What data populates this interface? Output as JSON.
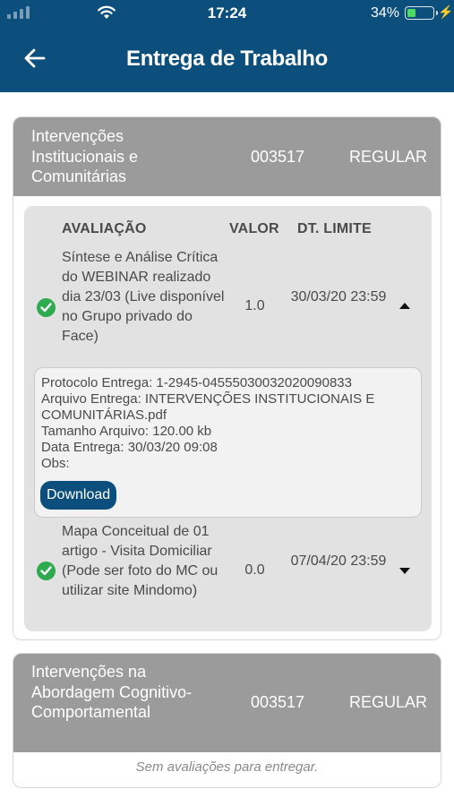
{
  "status_bar": {
    "time": "17:24",
    "battery_pct": "34%"
  },
  "header": {
    "title": "Entrega de Trabalho",
    "back_icon": "arrow-left-icon"
  },
  "colors": {
    "primary": "#0c4f7d",
    "card_header": "#9b9b9b",
    "success": "#2eaa4f"
  },
  "courses": [
    {
      "name": "Intervenções Institucionais e Comunitárias",
      "code": "003517",
      "status": "REGULAR",
      "table": {
        "col_eval": "AVALIAÇÃO",
        "col_value": "VALOR",
        "col_deadline": "DT. LIMITE"
      },
      "assessments": [
        {
          "description": "Síntese e Análise Crítica do WEBINAR realizado dia 23/03 (Live disponível no Grupo privado do Face)",
          "value": "1.0",
          "deadline": "30/03/20 23:59",
          "expanded": true,
          "detail": {
            "protocol_label": "Protocolo Entrega:",
            "protocol": "1-2945-04555030032020090833",
            "file_label": "Arquivo Entrega:",
            "file": "INTERVENÇÕES INSTITUCIONAIS E COMUNITÁRIAS.pdf",
            "size_label": "Tamanho Arquivo:",
            "size": "120.00 kb",
            "date_label": "Data Entrega:",
            "date": "30/03/20 09:08",
            "obs_label": "Obs:",
            "download_label": "Download"
          }
        },
        {
          "description": "Mapa Conceitual de 01 artigo - Visita Domiciliar (Pode ser foto do MC ou utilizar site Mindomo)",
          "value": "0.0",
          "deadline": "07/04/20 23:59",
          "expanded": false
        }
      ]
    },
    {
      "name": "Intervenções na Abordagem Cognitivo-Comportamental",
      "code": "003517",
      "status": "REGULAR",
      "empty_message": "Sem avaliações para entregar."
    }
  ]
}
